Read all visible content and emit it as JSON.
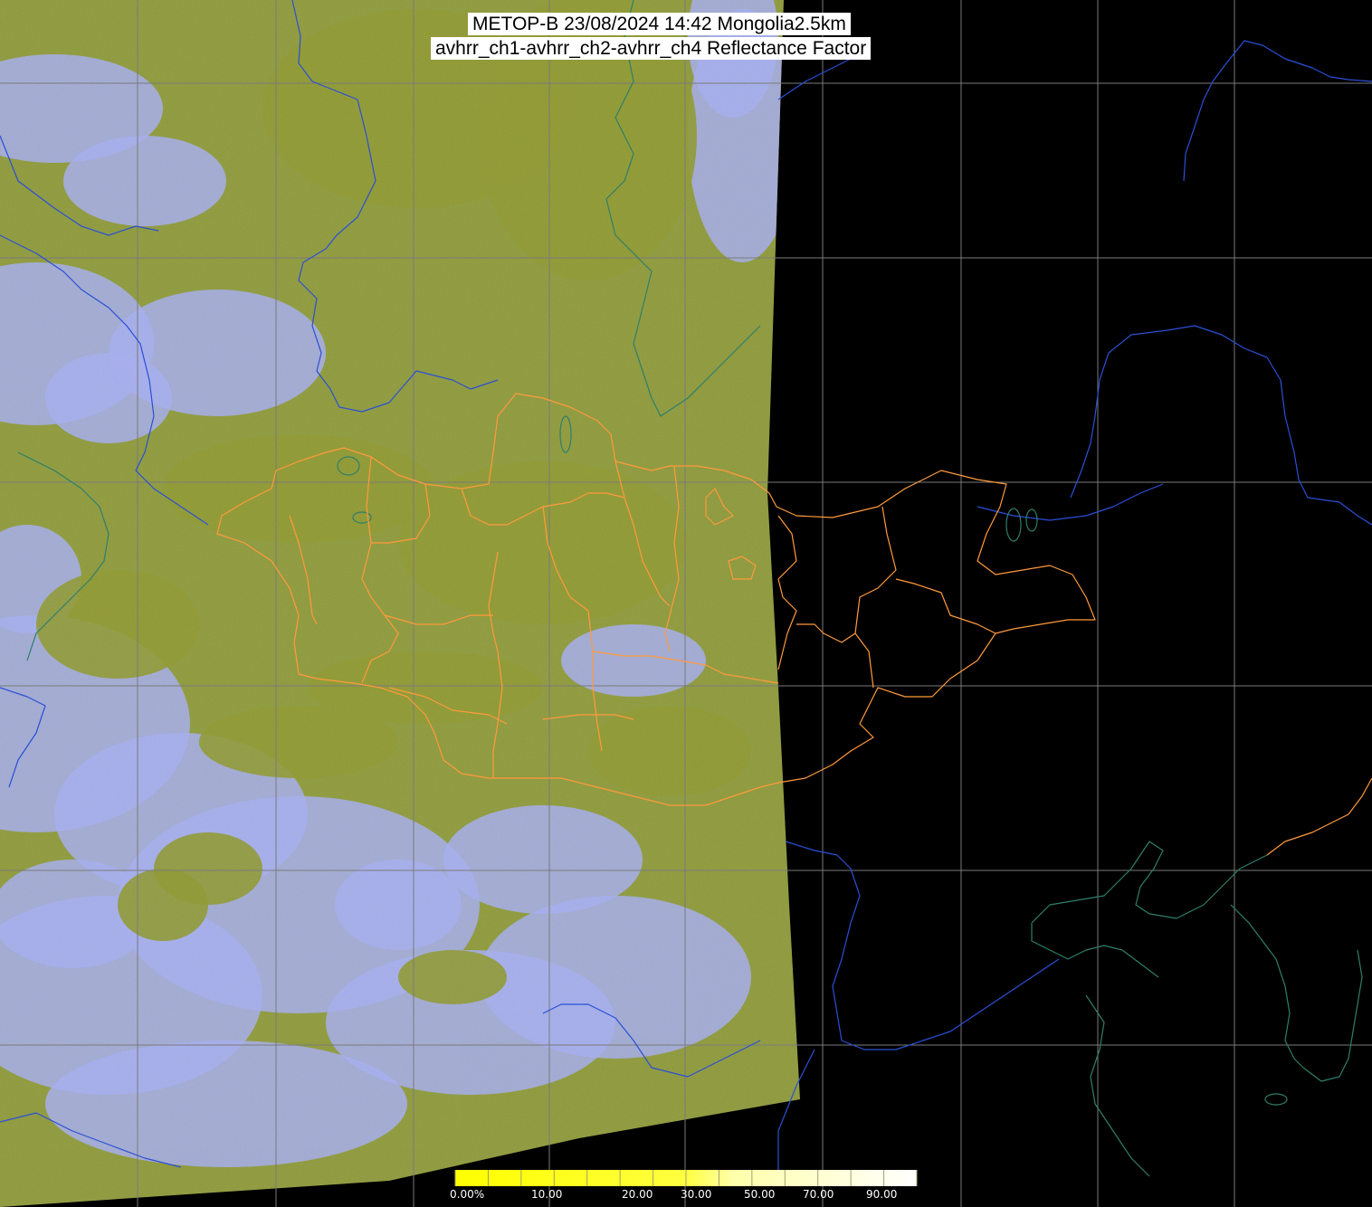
{
  "title": {
    "line1": "METOP-B 23/08/2024 14:42 Mongolia2.5km",
    "line2": "avhrr_ch1-avhrr_ch2-avhrr_ch4 Reflectance Factor"
  },
  "colors": {
    "background": "#000000",
    "swath_olive": "#8e9a3a",
    "swath_cloud": "#a6aef0",
    "grid": "#7a7a7a",
    "coastline_outside": "#2b4fd6",
    "coastline_inside": "#2f7f6a",
    "admin_boundaries": "#ff9a3c",
    "colorbar_low": "#ffff00",
    "colorbar_high": "#ffffff"
  },
  "colorbar": {
    "ticks": [
      "0.00%",
      "10.00",
      "20.00",
      "30.00",
      "50.00",
      "70.00",
      "90.00"
    ]
  }
}
